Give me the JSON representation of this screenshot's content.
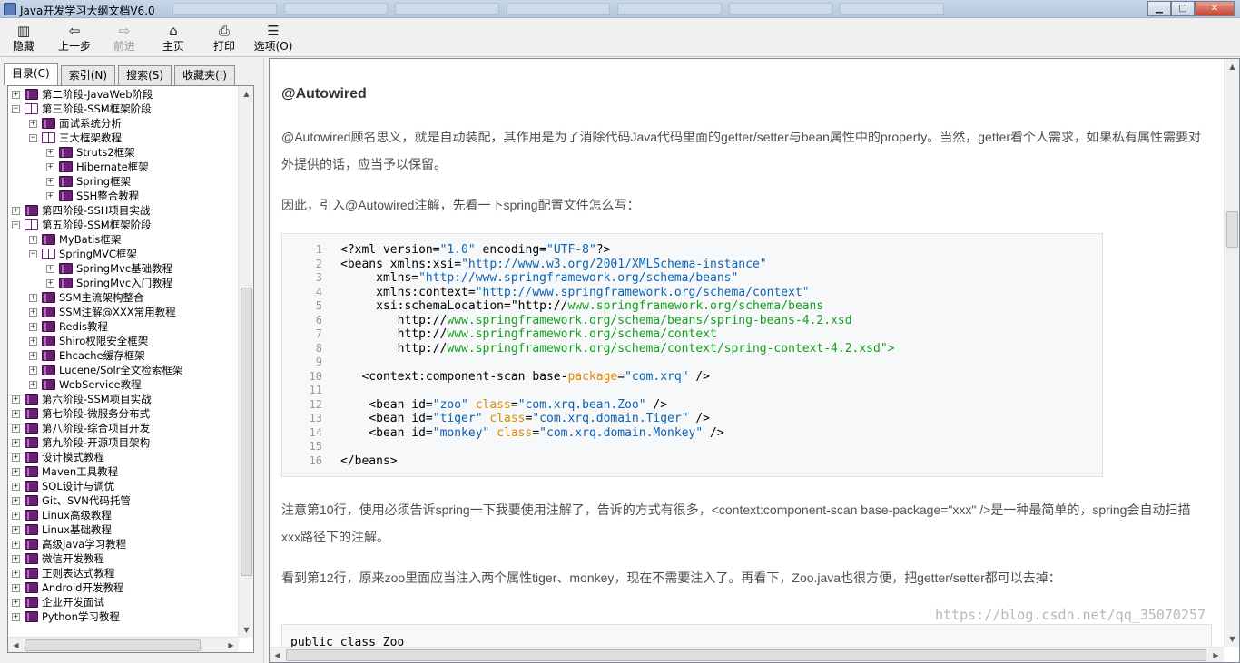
{
  "window": {
    "title": "Java开发学习大纲文档V6.0",
    "controls": [
      "minimize",
      "maximize",
      "close"
    ]
  },
  "toolbar": [
    {
      "id": "hide",
      "label": "隐藏",
      "icon": "hide-icon",
      "enabled": true
    },
    {
      "id": "back",
      "label": "上一步",
      "icon": "back-arrow-icon",
      "enabled": true
    },
    {
      "id": "forward",
      "label": "前进",
      "icon": "forward-arrow-icon",
      "enabled": false
    },
    {
      "id": "home",
      "label": "主页",
      "icon": "home-icon",
      "enabled": true
    },
    {
      "id": "print",
      "label": "打印",
      "icon": "print-icon",
      "enabled": true
    },
    {
      "id": "options",
      "label": "选项(O)",
      "icon": "options-icon",
      "enabled": true
    }
  ],
  "nav_tabs": [
    {
      "label": "目录(C)",
      "active": true
    },
    {
      "label": "索引(N)",
      "active": false
    },
    {
      "label": "搜索(S)",
      "active": false
    },
    {
      "label": "收藏夹(I)",
      "active": false
    }
  ],
  "tree": [
    {
      "level": 0,
      "label": "第二阶段-JavaWeb阶段",
      "expanded": false
    },
    {
      "level": 0,
      "label": "第三阶段-SSM框架阶段",
      "expanded": true
    },
    {
      "level": 1,
      "label": "面试系统分析",
      "expanded": false
    },
    {
      "level": 1,
      "label": "三大框架教程",
      "expanded": true
    },
    {
      "level": 2,
      "label": "Struts2框架",
      "expanded": false
    },
    {
      "level": 2,
      "label": "Hibernate框架",
      "expanded": false
    },
    {
      "level": 2,
      "label": "Spring框架",
      "expanded": false
    },
    {
      "level": 2,
      "label": "SSH整合教程",
      "expanded": false
    },
    {
      "level": 0,
      "label": "第四阶段-SSH项目实战",
      "expanded": false
    },
    {
      "level": 0,
      "label": "第五阶段-SSM框架阶段",
      "expanded": true
    },
    {
      "level": 1,
      "label": "MyBatis框架",
      "expanded": false
    },
    {
      "level": 1,
      "label": "SpringMVC框架",
      "expanded": true
    },
    {
      "level": 2,
      "label": "SpringMvc基础教程",
      "expanded": false
    },
    {
      "level": 2,
      "label": "SpringMvc入门教程",
      "expanded": false
    },
    {
      "level": 1,
      "label": "SSM主流架构整合",
      "expanded": false
    },
    {
      "level": 1,
      "label": "SSM注解@XXX常用教程",
      "expanded": false
    },
    {
      "level": 1,
      "label": "Redis教程",
      "expanded": false
    },
    {
      "level": 1,
      "label": "Shiro权限安全框架",
      "expanded": false
    },
    {
      "level": 1,
      "label": "Ehcache缓存框架",
      "expanded": false
    },
    {
      "level": 1,
      "label": "Lucene/Solr全文检索框架",
      "expanded": false
    },
    {
      "level": 1,
      "label": "WebService教程",
      "expanded": false
    },
    {
      "level": 0,
      "label": "第六阶段-SSM项目实战",
      "expanded": false
    },
    {
      "level": 0,
      "label": "第七阶段-微服务分布式",
      "expanded": false
    },
    {
      "level": 0,
      "label": "第八阶段-综合项目开发",
      "expanded": false
    },
    {
      "level": 0,
      "label": "第九阶段-开源项目架构",
      "expanded": false
    },
    {
      "level": 0,
      "label": "设计模式教程",
      "expanded": false
    },
    {
      "level": 0,
      "label": "Maven工具教程",
      "expanded": false
    },
    {
      "level": 0,
      "label": "SQL设计与调优",
      "expanded": false
    },
    {
      "level": 0,
      "label": "Git、SVN代码托管",
      "expanded": false
    },
    {
      "level": 0,
      "label": "Linux高级教程",
      "expanded": false
    },
    {
      "level": 0,
      "label": "Linux基础教程",
      "expanded": false
    },
    {
      "level": 0,
      "label": "高级Java学习教程",
      "expanded": false
    },
    {
      "level": 0,
      "label": "微信开发教程",
      "expanded": false
    },
    {
      "level": 0,
      "label": "正则表达式教程",
      "expanded": false
    },
    {
      "level": 0,
      "label": "Android开发教程",
      "expanded": false
    },
    {
      "level": 0,
      "label": "企业开发面试",
      "expanded": false
    },
    {
      "level": 0,
      "label": "Python学习教程",
      "expanded": false
    }
  ],
  "article": {
    "heading": "@Autowired",
    "para1": "@Autowired顾名思义，就是自动装配，其作用是为了消除代码Java代码里面的getter/setter与bean属性中的property。当然，getter看个人需求，如果私有属性需要对外提供的话，应当予以保留。",
    "para2": "因此，引入@Autowired注解，先看一下spring配置文件怎么写：",
    "para3": "注意第10行，使用必须告诉spring一下我要使用注解了，告诉的方式有很多，<context:component-scan   base-package=\"xxx\"  />是一种最简单的，spring会自动扫描xxx路径下的注解。",
    "para4": "看到第12行，原来zoo里面应当注入两个属性tiger、monkey，现在不需要注入了。再看下，Zoo.java也很方便，把getter/setter都可以去掉：",
    "code2_first_line": "public class Zoo",
    "watermark": "https://blog.csdn.net/qq_35070257"
  },
  "code_lines": [
    [
      [
        "t",
        "<?xml version="
      ],
      [
        "s",
        "\"1.0\""
      ],
      [
        "t",
        " encoding="
      ],
      [
        "s",
        "\"UTF-8\""
      ],
      [
        "t",
        "?>"
      ]
    ],
    [
      [
        "t",
        "<beans xmlns:xsi="
      ],
      [
        "s",
        "\"http://www.w3.org/2001/XMLSchema-instance\""
      ]
    ],
    [
      [
        "t",
        "     xmlns="
      ],
      [
        "s",
        "\"http://www.springframework.org/schema/beans\""
      ]
    ],
    [
      [
        "t",
        "     xmlns:context="
      ],
      [
        "s",
        "\"http://www.springframework.org/schema/context\""
      ]
    ],
    [
      [
        "t",
        "     xsi:schemaLocation=\"http://"
      ],
      [
        "u",
        "www.springframework.org/schema/beans"
      ]
    ],
    [
      [
        "t",
        "        http://"
      ],
      [
        "u",
        "www.springframework.org/schema/beans/spring-beans-4.2.xsd"
      ]
    ],
    [
      [
        "t",
        "        http://"
      ],
      [
        "u",
        "www.springframework.org/schema/context"
      ]
    ],
    [
      [
        "t",
        "        http://"
      ],
      [
        "u",
        "www.springframework.org/schema/context/spring-context-4.2.xsd\">"
      ]
    ],
    [
      [
        "t",
        ""
      ]
    ],
    [
      [
        "t",
        "   <context:component-scan base-"
      ],
      [
        "k",
        "package"
      ],
      [
        "t",
        "="
      ],
      [
        "s",
        "\"com.xrq\""
      ],
      [
        "t",
        " />"
      ]
    ],
    [
      [
        "t",
        ""
      ]
    ],
    [
      [
        "t",
        "    <bean id="
      ],
      [
        "s",
        "\"zoo\""
      ],
      [
        "t",
        " "
      ],
      [
        "k",
        "class"
      ],
      [
        "t",
        "="
      ],
      [
        "s",
        "\"com.xrq.bean.Zoo\""
      ],
      [
        "t",
        " />"
      ]
    ],
    [
      [
        "t",
        "    <bean id="
      ],
      [
        "s",
        "\"tiger\""
      ],
      [
        "t",
        " "
      ],
      [
        "k",
        "class"
      ],
      [
        "t",
        "="
      ],
      [
        "s",
        "\"com.xrq.domain.Tiger\""
      ],
      [
        "t",
        " />"
      ]
    ],
    [
      [
        "t",
        "    <bean id="
      ],
      [
        "s",
        "\"monkey\""
      ],
      [
        "t",
        " "
      ],
      [
        "k",
        "class"
      ],
      [
        "t",
        "="
      ],
      [
        "s",
        "\"com.xrq.domain.Monkey\""
      ],
      [
        "t",
        " />"
      ]
    ],
    [
      [
        "t",
        ""
      ]
    ],
    [
      [
        "t",
        "</beans>"
      ]
    ]
  ]
}
